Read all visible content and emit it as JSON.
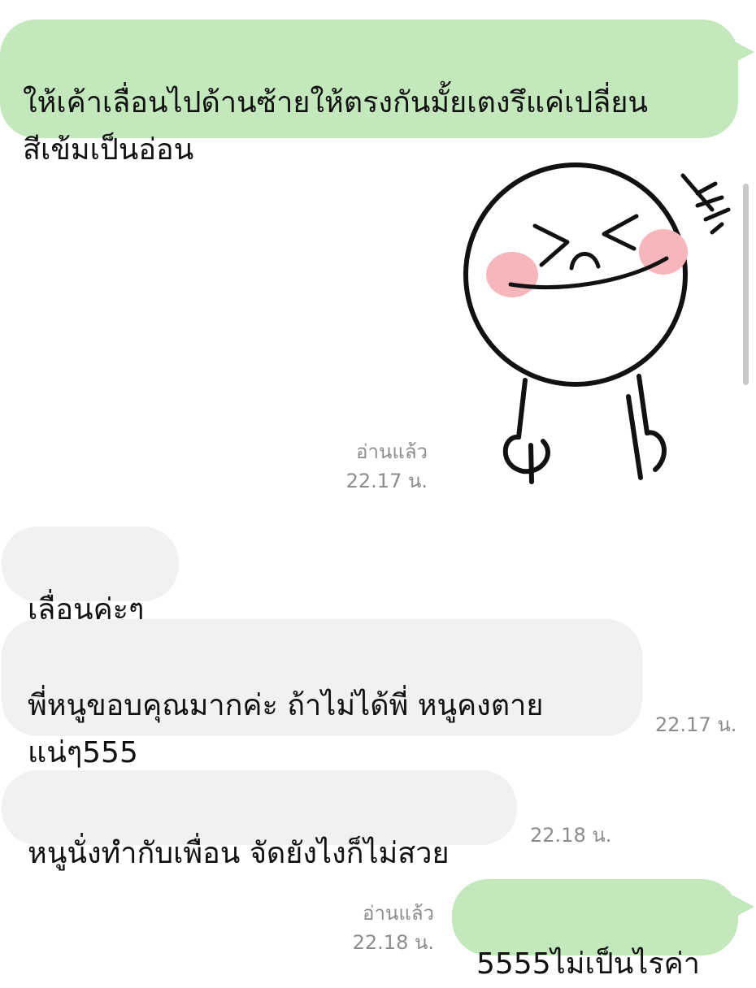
{
  "chat": {
    "messages": [
      {
        "side": "out",
        "text": "ให้เค้าเลื่อนไปด้านซ้ายให้ตรงกันมั้ยเตงรึแค่เปลี่ยน\nสีเข้มเป็นอ่อน"
      },
      {
        "side": "out",
        "type": "sticker",
        "sticker": "laughing-moon-face-sticker",
        "read_label": "อ่านแล้ว",
        "time": "22.17 น."
      },
      {
        "side": "in",
        "text": "เลื่อนค่ะๆ"
      },
      {
        "side": "in",
        "text": "พี่หนูขอบคุณมากค่ะ ถ้าไม่ได้พี่ หนูคงตาย\nแน่ๆ555",
        "time": "22.17 น."
      },
      {
        "side": "in",
        "text": "หนูนั่งทำกับเพื่อน จัดยังไงก็ไม่สวย",
        "time": "22.18 น."
      },
      {
        "side": "out",
        "text": "5555ไม่เป็นไรค่า",
        "read_label": "อ่านแล้ว",
        "time": "22.18 น."
      }
    ]
  },
  "colors": {
    "outgoing_bubble": "#c3e8bc",
    "incoming_bubble": "#f0f1f3",
    "meta_text": "#8c8c8c"
  }
}
